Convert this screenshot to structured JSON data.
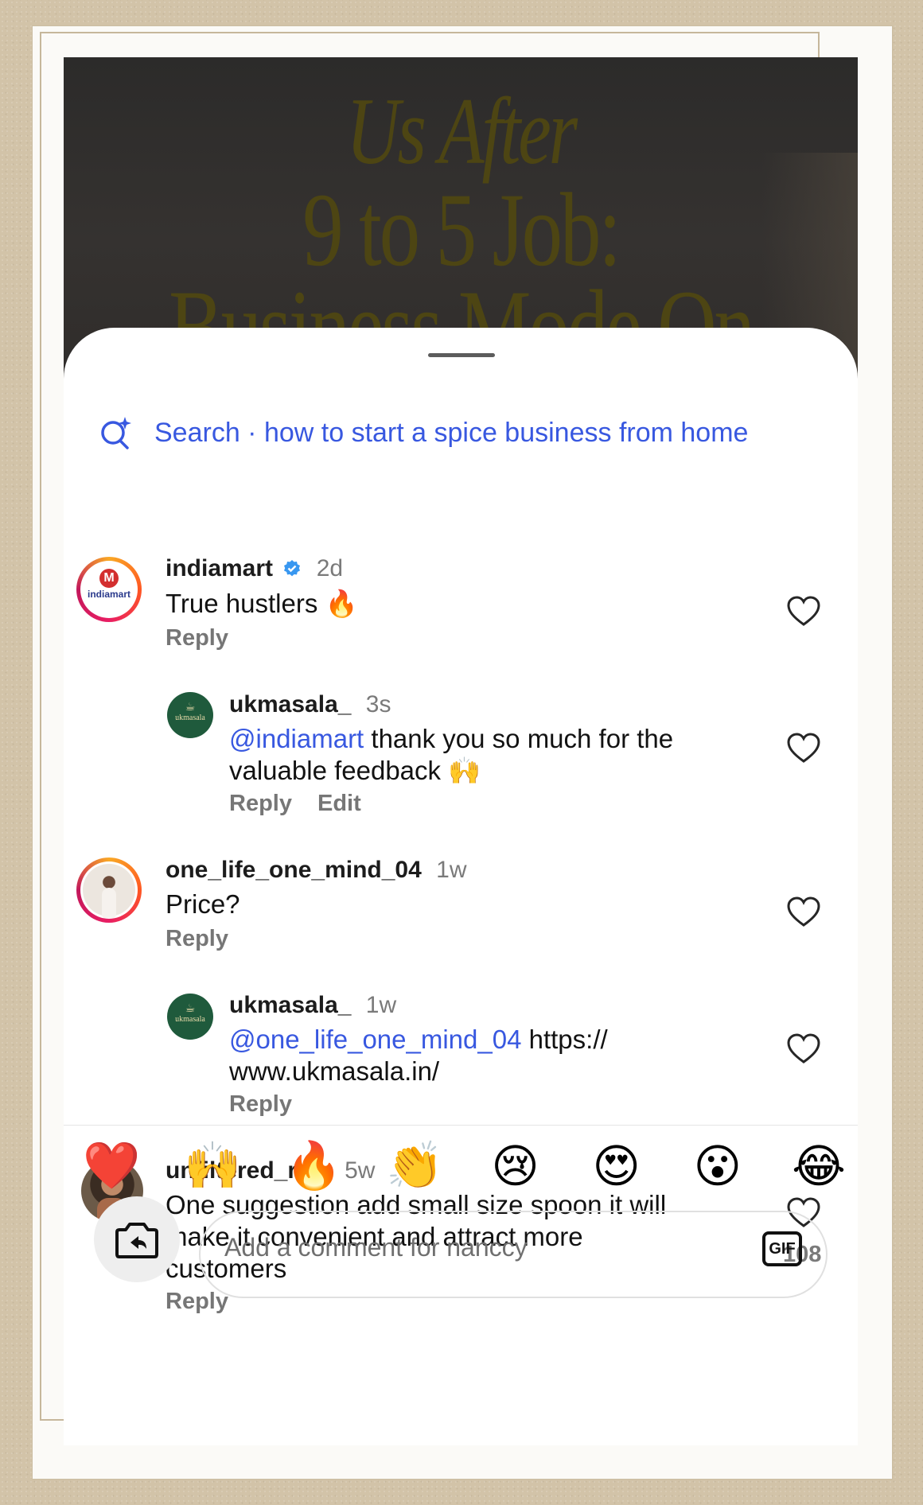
{
  "video": {
    "overlay_line1": "Us After",
    "overlay_line2": "9 to 5 Job:",
    "overlay_line3": "Business Mode On"
  },
  "search": {
    "icon": "sparkle-search-icon",
    "text": "Search · how to start a spice business from home"
  },
  "comments": [
    {
      "username": "indiamart",
      "verified": true,
      "time": "2d",
      "text": "True hustlers 🔥",
      "reply_label": "Reply",
      "avatar_text": "indiamart"
    },
    {
      "username": "ukmasala_",
      "time": "3s",
      "mention": "@indiamart",
      "text_line1": " thank you so much for the",
      "text_line2": "valuable feedback 🙌",
      "reply_label": "Reply",
      "edit_label": "Edit",
      "avatar_text": "ukmasala"
    },
    {
      "username": "one_life_one_mind_04",
      "time": "1w",
      "text": "Price?",
      "reply_label": "Reply"
    },
    {
      "username": "ukmasala_",
      "time": "1w",
      "mention": "@one_life_one_mind_04",
      "text_line1": " https://",
      "text_line2": "www.ukmasala.in/",
      "reply_label": "Reply",
      "avatar_text": "ukmasala"
    },
    {
      "username": "unfiltered_raj_",
      "time": "5w",
      "text_line1": "One suggestion add small size spoon it will",
      "text_line2": "make it convenient and attract more",
      "text_line3": "customers",
      "reply_label": "Reply",
      "likes": "108"
    }
  ],
  "emoji_bar": [
    "❤️",
    "🙌",
    "🔥",
    "👏",
    "😢",
    "😍",
    "😮",
    "😂"
  ],
  "composer": {
    "placeholder": "Add a comment for   nanccy",
    "gif_label": "GIF"
  }
}
